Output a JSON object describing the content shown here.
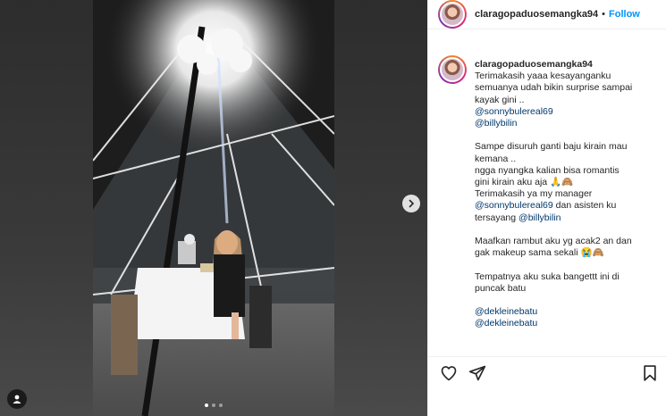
{
  "header": {
    "username": "claragopaduosemangka94",
    "separator": "•",
    "follow_label": "Follow"
  },
  "caption": {
    "username": "claragopaduosemangka94",
    "lines": [
      {
        "parts": [
          {
            "t": "Terimakasih yaaa kesayanganku"
          }
        ]
      },
      {
        "parts": [
          {
            "t": "semuanya udah bikin surprise sampai"
          }
        ]
      },
      {
        "parts": [
          {
            "t": "kayak gini .."
          }
        ]
      },
      {
        "parts": [
          {
            "t": "@sonnybulereal69",
            "m": true
          }
        ]
      },
      {
        "parts": [
          {
            "t": "@billybilin",
            "m": true
          }
        ]
      },
      {
        "gap": true
      },
      {
        "parts": [
          {
            "t": "Sampe disuruh ganti baju kirain mau"
          }
        ]
      },
      {
        "parts": [
          {
            "t": "kemana .."
          }
        ]
      },
      {
        "parts": [
          {
            "t": "ngga nyangka kalian bisa romantis"
          }
        ]
      },
      {
        "parts": [
          {
            "t": "gini kirain aku aja 🙏🙈"
          }
        ]
      },
      {
        "parts": [
          {
            "t": "Terimakasih ya my manager"
          }
        ]
      },
      {
        "parts": [
          {
            "t": "@sonnybulereal69",
            "m": true
          },
          {
            "t": " dan asisten ku"
          }
        ]
      },
      {
        "parts": [
          {
            "t": "tersayang "
          },
          {
            "t": "@billybilin",
            "m": true
          }
        ]
      },
      {
        "gap": true
      },
      {
        "parts": [
          {
            "t": "Maafkan rambut aku yg acak2 an dan"
          }
        ]
      },
      {
        "parts": [
          {
            "t": "gak makeup sama sekali 😭🙈"
          }
        ]
      },
      {
        "gap": true
      },
      {
        "parts": [
          {
            "t": "Tempatnya aku suka bangettt ini di"
          }
        ]
      },
      {
        "parts": [
          {
            "t": "puncak batu"
          }
        ]
      },
      {
        "gap": true
      },
      {
        "parts": [
          {
            "t": "@dekleinebatu",
            "m": true
          }
        ]
      },
      {
        "parts": [
          {
            "t": "@dekleinebatu",
            "m": true
          }
        ]
      }
    ]
  },
  "icons": {
    "next": "chevron-right-icon",
    "user_tag": "user-icon",
    "like": "heart-icon",
    "share": "paper-plane-icon",
    "save": "bookmark-icon"
  },
  "carousel": {
    "count": 3,
    "active": 1
  },
  "colors": {
    "link": "#00376b",
    "follow": "#0095f6",
    "text": "#262626"
  }
}
